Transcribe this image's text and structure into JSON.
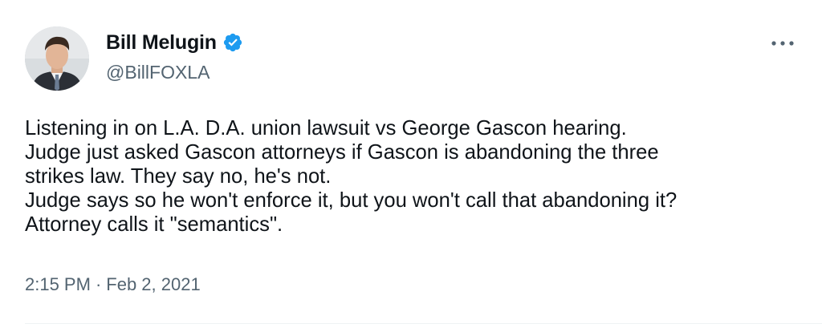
{
  "author": {
    "display_name": "Bill Melugin",
    "handle": "@BillFOXLA",
    "verified": true,
    "avatar_icon": "profile-photo"
  },
  "tweet": {
    "lines": [
      "Listening in on L.A. D.A. union lawsuit vs George Gascon hearing.",
      "Judge just asked Gascon attorneys if Gascon is abandoning the three",
      "strikes law. They say no, he's not.",
      "Judge says so he won't enforce it, but you won't call that abandoning it?",
      "Attorney calls it \"semantics\"."
    ],
    "time": "2:15 PM",
    "separator": "·",
    "date": "Feb 2, 2021"
  },
  "menu": {
    "icon": "more-horizontal-icon"
  },
  "colors": {
    "text_primary": "#0f1419",
    "text_secondary": "#536471",
    "verified_blue": "#1d9bf0",
    "divider": "#eff3f4"
  }
}
